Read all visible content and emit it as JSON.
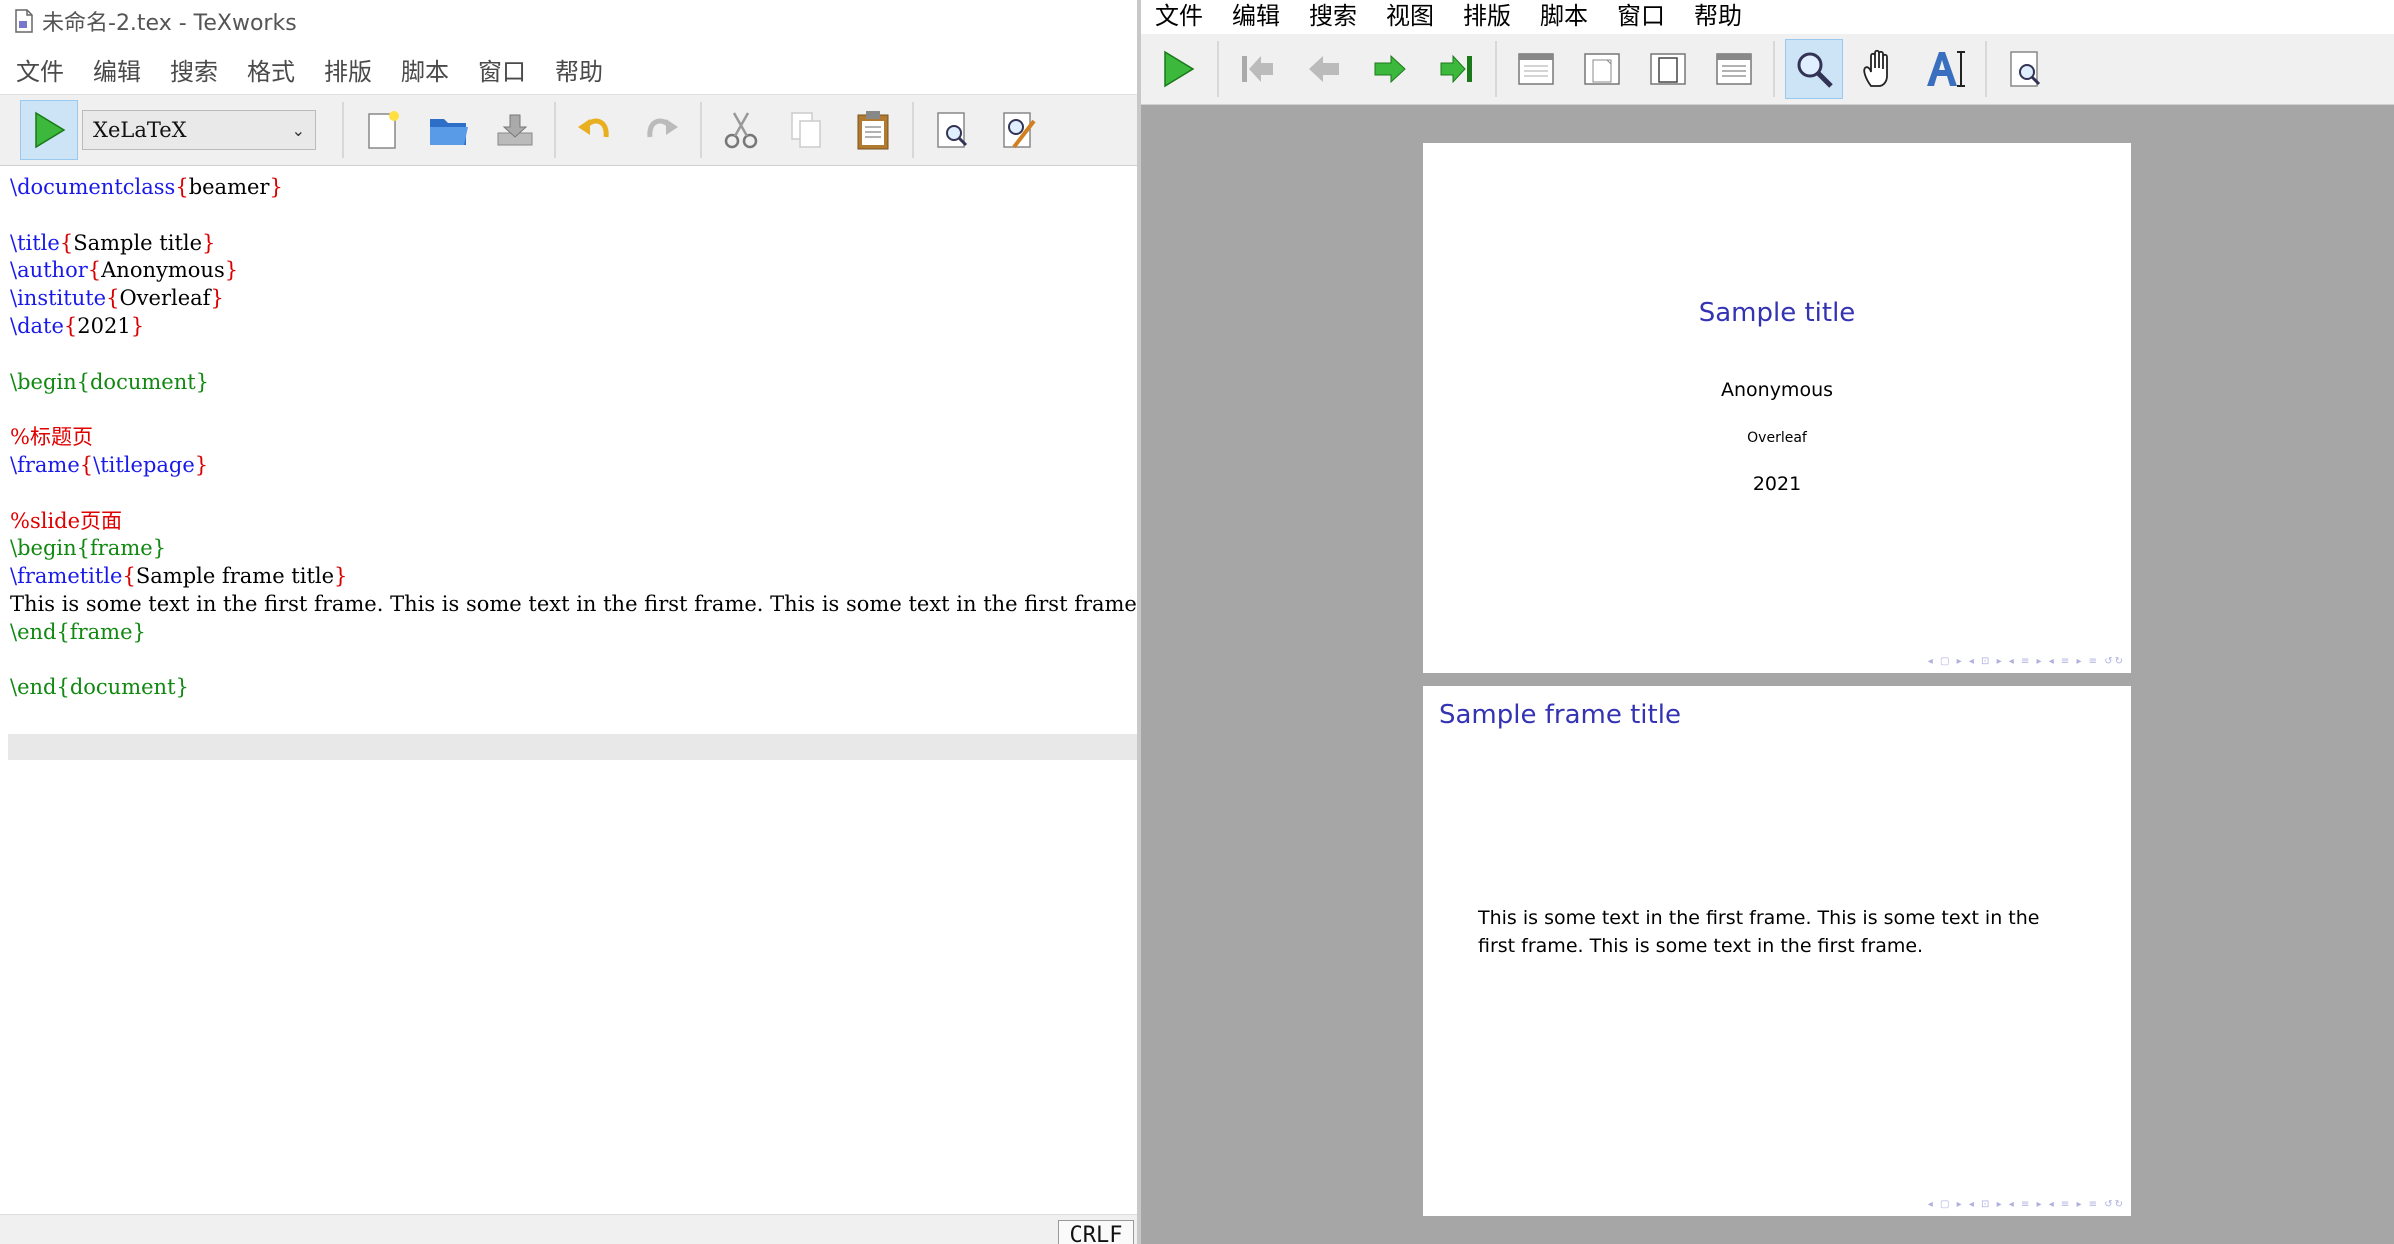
{
  "editor_window": {
    "title": "未命名-2.tex - TeXworks",
    "menu": [
      "文件",
      "编辑",
      "搜索",
      "格式",
      "排版",
      "脚本",
      "窗口",
      "帮助"
    ],
    "engine": "XeLaTeX",
    "status": {
      "line_ending": "CRLF"
    },
    "code": [
      [
        {
          "t": "cmd",
          "v": "\\documentclass"
        },
        {
          "t": "br",
          "v": "{"
        },
        {
          "t": "arg",
          "v": "beamer"
        },
        {
          "t": "br",
          "v": "}"
        }
      ],
      [],
      [
        {
          "t": "cmd",
          "v": "\\title"
        },
        {
          "t": "br",
          "v": "{"
        },
        {
          "t": "arg",
          "v": "Sample title"
        },
        {
          "t": "br",
          "v": "}"
        }
      ],
      [
        {
          "t": "cmd",
          "v": "\\author"
        },
        {
          "t": "br",
          "v": "{"
        },
        {
          "t": "arg",
          "v": "Anonymous"
        },
        {
          "t": "br",
          "v": "}"
        }
      ],
      [
        {
          "t": "cmd",
          "v": "\\institute"
        },
        {
          "t": "br",
          "v": "{"
        },
        {
          "t": "arg",
          "v": "Overleaf"
        },
        {
          "t": "br",
          "v": "}"
        }
      ],
      [
        {
          "t": "cmd",
          "v": "\\date"
        },
        {
          "t": "br",
          "v": "{"
        },
        {
          "t": "arg",
          "v": "2021"
        },
        {
          "t": "br",
          "v": "}"
        }
      ],
      [],
      [
        {
          "t": "env",
          "v": "\\begin{document}"
        }
      ],
      [],
      [
        {
          "t": "comment",
          "v": "%标题页"
        }
      ],
      [
        {
          "t": "cmd",
          "v": "\\frame"
        },
        {
          "t": "br",
          "v": "{"
        },
        {
          "t": "cmd",
          "v": "\\titlepage"
        },
        {
          "t": "br",
          "v": "}"
        }
      ],
      [],
      [
        {
          "t": "comment",
          "v": "%slide页面"
        }
      ],
      [
        {
          "t": "env",
          "v": "\\begin{frame}"
        }
      ],
      [
        {
          "t": "cmd",
          "v": "\\frametitle"
        },
        {
          "t": "br",
          "v": "{"
        },
        {
          "t": "arg",
          "v": "Sample frame title"
        },
        {
          "t": "br",
          "v": "}"
        }
      ],
      [
        {
          "t": "arg",
          "v": "This is some text in the first frame. This is some text in the first frame. This is some text in the first frame."
        }
      ],
      [
        {
          "t": "env",
          "v": "\\end{frame}"
        }
      ],
      [],
      [
        {
          "t": "env",
          "v": "\\end{document}"
        }
      ]
    ]
  },
  "preview_window": {
    "menu": [
      "文件",
      "编辑",
      "搜索",
      "视图",
      "排版",
      "脚本",
      "窗口",
      "帮助"
    ],
    "slide1": {
      "title": "Sample title",
      "author": "Anonymous",
      "institute": "Overleaf",
      "date": "2021"
    },
    "slide2": {
      "frame_title": "Sample frame title",
      "body": "This is some text in the first frame.  This is some text in the first frame.  This is some text in the first frame."
    },
    "nav_symbols": "◂ ▢ ▸  ◂ ⊡ ▸  ◂ ≡ ▸  ◂ ≡ ▸   ≡   ↺↻"
  },
  "colors": {
    "command": "#1a1ae8",
    "brace": "#d80000",
    "environment": "#118811",
    "comment": "#e00000",
    "beamer_title": "#3333b3",
    "viewer_bg": "#a6a6a6"
  }
}
